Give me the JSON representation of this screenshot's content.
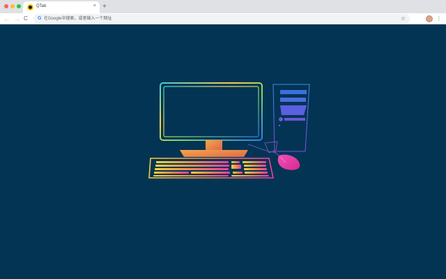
{
  "window": {
    "traffic_lights": [
      "close",
      "minimize",
      "zoom"
    ]
  },
  "tab": {
    "title": "QTab",
    "favicon": "qtab-logo-icon",
    "close_glyph": "×"
  },
  "new_tab": {
    "glyph": "+"
  },
  "toolbar": {
    "back_glyph": "←",
    "forward_glyph": "→",
    "reload_glyph": "C",
    "search_engine_glyph": "G",
    "omnibox_placeholder": "在Google中搜索，或者输入一个网址",
    "bookmark_glyph": "☆",
    "menu_glyph": "⋮"
  },
  "page": {
    "background": "#043454",
    "illustration": "desktop-computer-illustration"
  },
  "colors": {
    "chrome_bg": "#dfe1e5",
    "accent_pink": "#ec3fa6",
    "accent_blue": "#3b6fe0",
    "accent_yellow": "#f0c23a"
  }
}
